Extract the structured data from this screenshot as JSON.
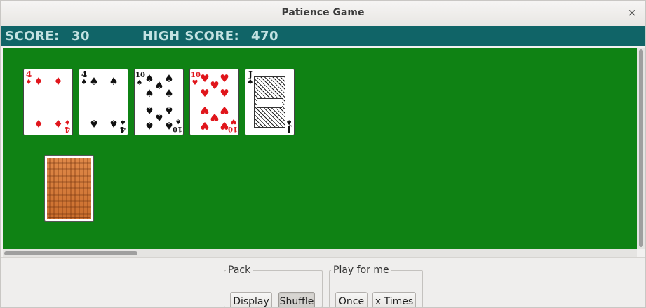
{
  "window": {
    "title": "Patience Game",
    "close_glyph": "×"
  },
  "scorebar": {
    "score_label": "SCORE:",
    "score_value": "30",
    "high_score_label": "HIGH SCORE:",
    "high_score_value": "470",
    "background_color": "#106467",
    "text_color": "#c3e2e2"
  },
  "table": {
    "felt_color": "#0f8214",
    "cards_in_row": [
      {
        "rank": "4",
        "suit": "diamonds",
        "symbol": "♦",
        "color": "red"
      },
      {
        "rank": "4",
        "suit": "spades",
        "symbol": "♠",
        "color": "black"
      },
      {
        "rank": "10",
        "suit": "spades",
        "symbol": "♠",
        "color": "black"
      },
      {
        "rank": "10",
        "suit": "hearts",
        "symbol": "♥",
        "color": "red"
      },
      {
        "rank": "J",
        "suit": "spades",
        "symbol": "♠",
        "color": "black"
      }
    ],
    "pack": {
      "face": "down",
      "icon": "card-back"
    }
  },
  "controls": {
    "pack_group": {
      "legend": "Pack",
      "display_label": "Display",
      "shuffle_label": "Shuffle"
    },
    "play_group": {
      "legend": "Play for me",
      "once_label": "Once",
      "x_times_label": "x Times"
    }
  }
}
